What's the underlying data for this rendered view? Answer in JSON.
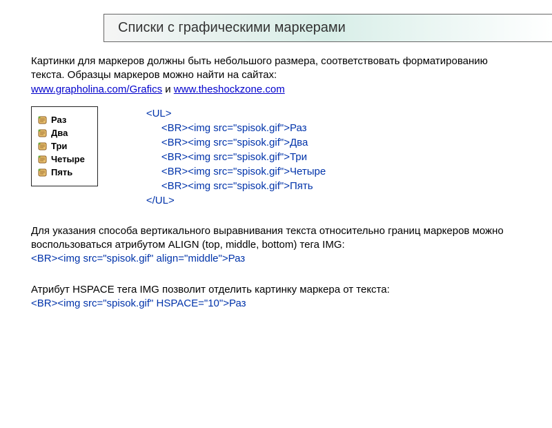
{
  "title": "Списки с графическими маркерами",
  "intro": {
    "line1": "Картинки для маркеров должны быть небольшого размера, соответствовать форматированию текста. Образцы маркеров можно найти на сайтах:",
    "link1": "www.grapholina.com/Grafics",
    "sep": " и ",
    "link2": "www.theshockzone.com"
  },
  "demo_items": [
    "Раз",
    "Два",
    "Три",
    "Четыре",
    "Пять"
  ],
  "code": {
    "open": "<UL>",
    "items": [
      "<BR><img src=\"spisok.gif\">Раз",
      "<BR><img src=\"spisok.gif\">Два",
      "<BR><img src=\"spisok.gif\">Три",
      "<BR><img src=\"spisok.gif\">Четыре",
      "<BR><img src=\"spisok.gif\">Пять"
    ],
    "close": "</UL>"
  },
  "align_section": {
    "text": "Для указания способа вертикального выравнивания текста относительно границ маркеров можно воспользоваться атрибутом ALIGN (top, middle, bottom) тега IMG:",
    "code": "<BR><img src=\"spisok.gif\" align=\"middle\">Раз"
  },
  "hspace_section": {
    "text": "Атрибут HSPACE тега IMG позволит отделить картинку маркера от текста:",
    "code": "<BR><img src=\"spisok.gif\" HSPACE=\"10\">Раз"
  }
}
